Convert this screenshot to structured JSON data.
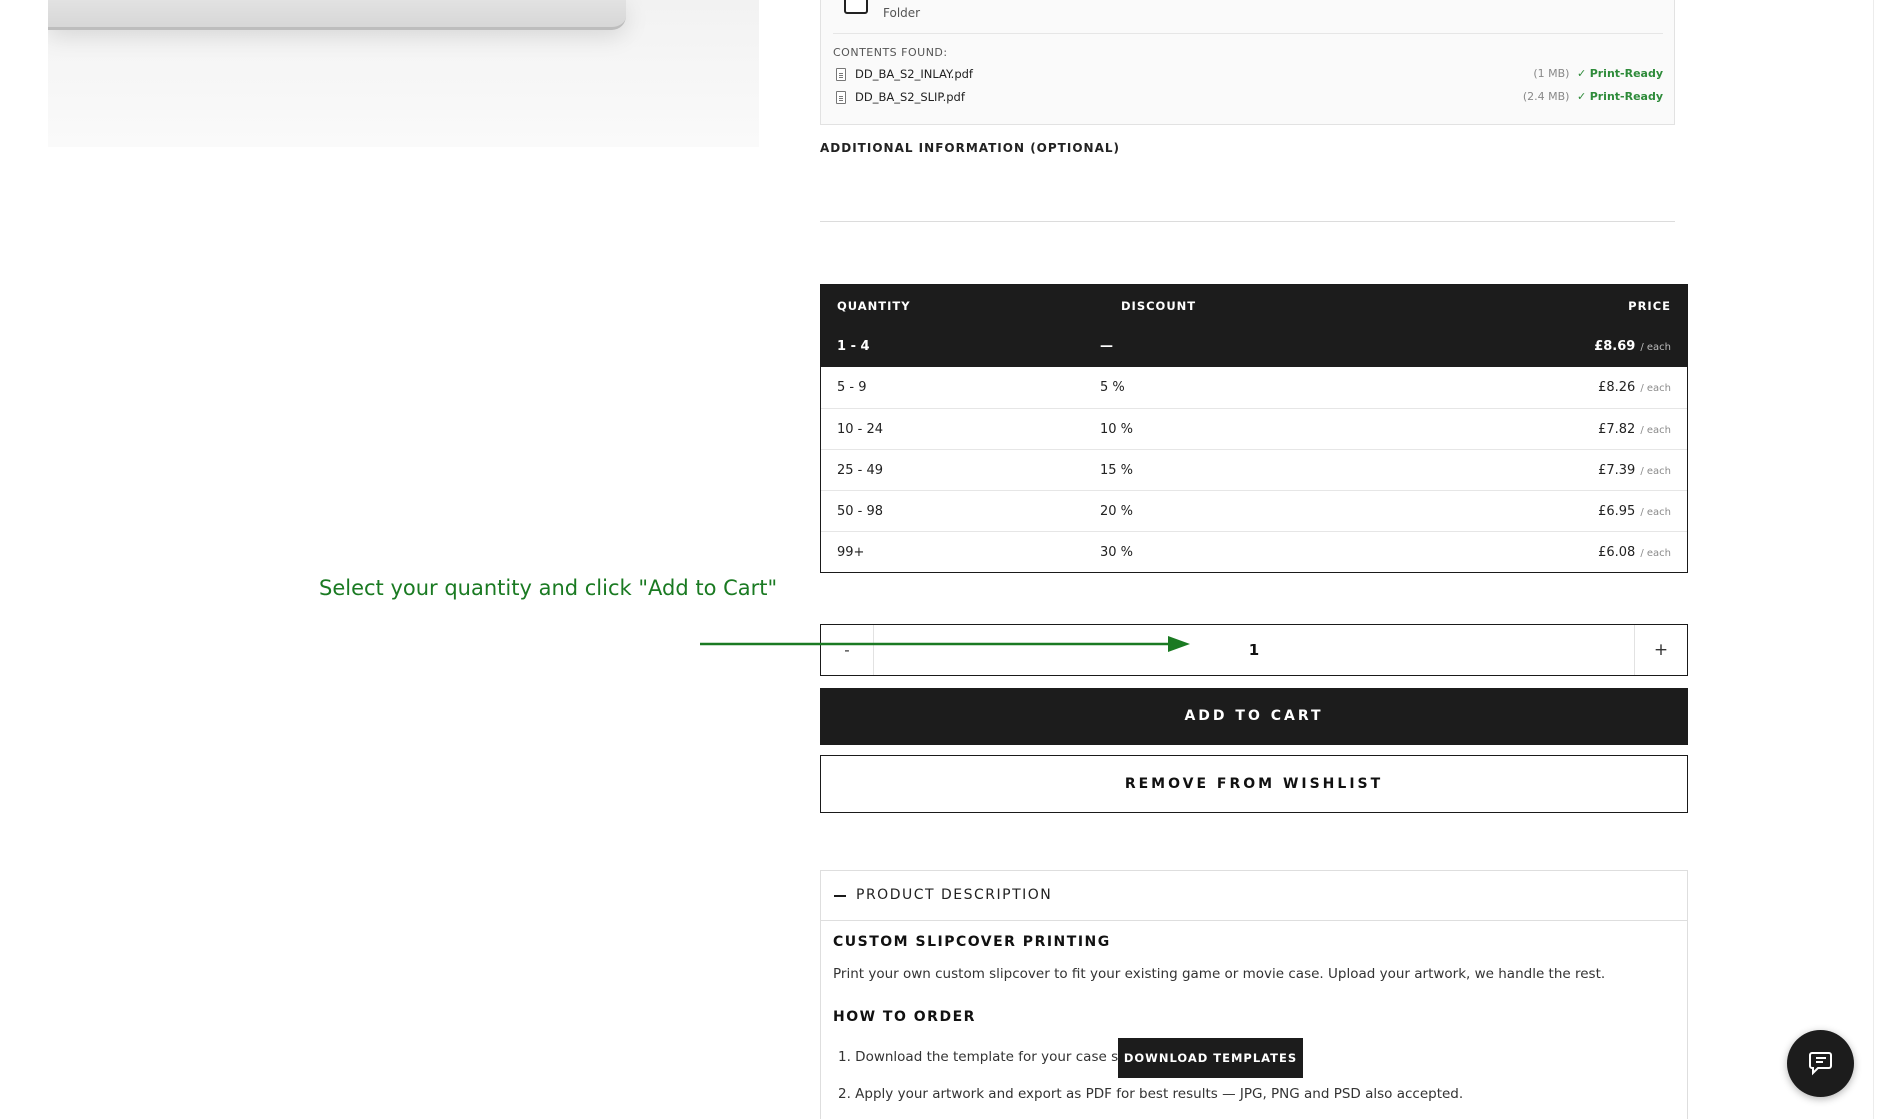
{
  "files": {
    "folder_label": "Folder",
    "contents_title": "CONTENTS FOUND:",
    "items": [
      {
        "name": "DD_BA_S2_INLAY.pdf",
        "size": "(1 MB)",
        "check": "✓",
        "status": "Print-Ready"
      },
      {
        "name": "DD_BA_S2_SLIP.pdf",
        "size": "(2.4 MB)",
        "check": "✓",
        "status": "Print-Ready"
      }
    ]
  },
  "additional_info": {
    "label": "ADDITIONAL INFORMATION (OPTIONAL)"
  },
  "pricing": {
    "headers": {
      "quantity": "QUANTITY",
      "discount": "DISCOUNT",
      "price": "PRICE"
    },
    "each_label": "/ each",
    "rows": [
      {
        "qty": "1 - 4",
        "discount": "—",
        "price": "£8.69"
      },
      {
        "qty": "5 - 9",
        "discount": "5 %",
        "price": "£8.26"
      },
      {
        "qty": "10 - 24",
        "discount": "10 %",
        "price": "£7.82"
      },
      {
        "qty": "25 - 49",
        "discount": "15 %",
        "price": "£7.39"
      },
      {
        "qty": "50 - 98",
        "discount": "20 %",
        "price": "£6.95"
      },
      {
        "qty": "99+",
        "discount": "30 %",
        "price": "£6.08"
      }
    ],
    "active_row": 0
  },
  "annotation": {
    "text": "Select your quantity and click \"Add to Cart\"",
    "color": "#1a7a22"
  },
  "stepper": {
    "minus": "-",
    "value": "1",
    "plus": "+"
  },
  "buttons": {
    "add_to_cart": "ADD TO CART",
    "remove_wishlist": "REMOVE FROM WISHLIST"
  },
  "description": {
    "toggle_title": "PRODUCT DESCRIPTION",
    "heading": "CUSTOM SLIPCOVER PRINTING",
    "intro": "Print your own custom slipcover to fit your existing game or movie case. Upload your artwork, we handle the rest.",
    "how_heading": "HOW TO ORDER",
    "step1": "1. Download the template for your case size",
    "download_button": "DOWNLOAD TEMPLATES",
    "step2": "2. Apply your artwork and export as PDF for best results — JPG, PNG and PSD also accepted."
  },
  "icons": {
    "chat": "chat-icon",
    "document": "document-icon",
    "folder": "folder-icon",
    "collapse": "minus-icon"
  },
  "colors": {
    "dark": "#1c1c1c",
    "ready_green": "#2e8b3a",
    "annotation_green": "#1a7a22"
  }
}
